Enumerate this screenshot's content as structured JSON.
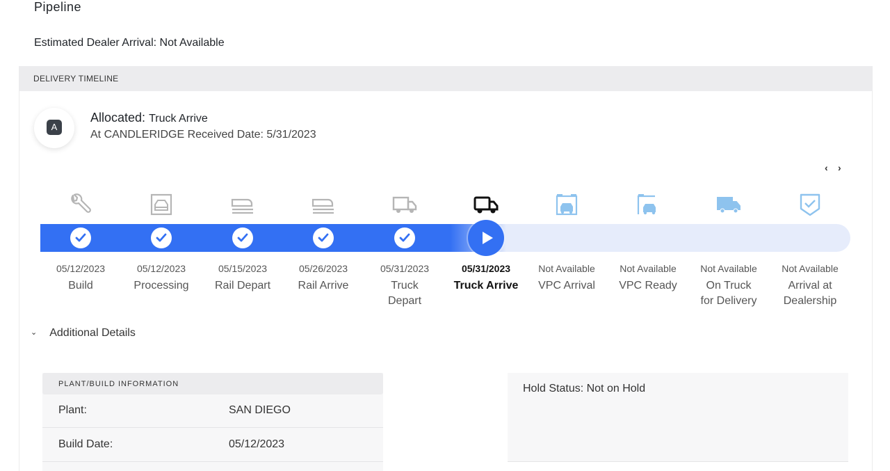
{
  "page": {
    "title": "Pipeline",
    "eta": "Estimated Dealer Arrival: Not Available"
  },
  "timeline": {
    "header": "DELIVERY TIMELINE",
    "status": {
      "badge": "A",
      "label": "Allocated:",
      "sub_label": "Truck Arrive",
      "location_line": "At CANDLERIDGE Received Date: 5/31/2023"
    },
    "nav": {
      "prev": "‹",
      "next": "›"
    },
    "current_stage": "Truck Arrive",
    "stages": [
      {
        "date": "05/12/2023",
        "name": "Build",
        "icon": "wrench-icon",
        "state": "complete"
      },
      {
        "date": "05/12/2023",
        "name": "Processing",
        "icon": "factory-icon",
        "state": "complete"
      },
      {
        "date": "05/15/2023",
        "name": "Rail Depart",
        "icon": "rail-car-icon",
        "state": "complete"
      },
      {
        "date": "05/26/2023",
        "name": "Rail Arrive",
        "icon": "rail-car-icon",
        "state": "complete"
      },
      {
        "date": "05/31/2023",
        "name": "Truck Depart",
        "icon": "truck-icon",
        "state": "complete"
      },
      {
        "date": "05/31/2023",
        "name": "Truck Arrive",
        "icon": "truck-icon",
        "state": "current"
      },
      {
        "date": "Not Available",
        "name": "VPC Arrival",
        "icon": "vpc-building-icon",
        "state": "pending"
      },
      {
        "date": "Not Available",
        "name": "VPC Ready",
        "icon": "vpc-building-icon",
        "state": "pending"
      },
      {
        "date": "Not Available",
        "name": "On Truck for Delivery",
        "icon": "truck-icon",
        "state": "pending"
      },
      {
        "date": "Not Available",
        "name": "Arrival at Dealership",
        "icon": "shield-check-icon",
        "state": "pending"
      }
    ]
  },
  "details": {
    "toggle_label": "Additional Details",
    "plant_card": {
      "header": "PLANT/BUILD INFORMATION",
      "rows": [
        {
          "key": "Plant:",
          "value": "SAN DIEGO"
        },
        {
          "key": "Build Date:",
          "value": "05/12/2023"
        }
      ]
    },
    "hold_status": "Hold Status: Not on Hold"
  },
  "colors": {
    "accent": "#3370f3",
    "track_light": "#e6ecfb",
    "icon_done": "#b5b5b5",
    "icon_current": "#111111",
    "icon_pending": "#8ec3ee"
  }
}
